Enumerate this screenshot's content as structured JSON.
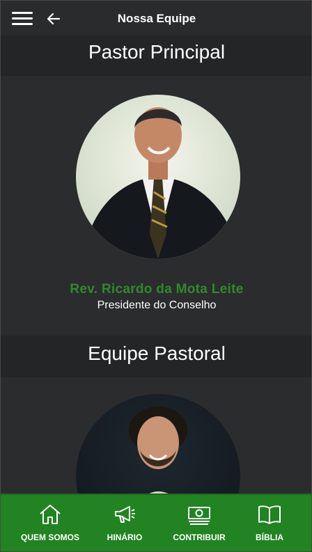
{
  "header": {
    "title": "Nossa Equipe",
    "menu_icon": "hamburger-menu-icon",
    "back_icon": "arrow-left-icon"
  },
  "sections": [
    {
      "title": "Pastor Principal"
    },
    {
      "title": "Equipe Pastoral"
    }
  ],
  "lead_pastor": {
    "name": "Rev. Ricardo da Mota Leite",
    "role": "Presidente do Conselho"
  },
  "nav": [
    {
      "label": "QUEM SOMOS",
      "icon": "home-icon"
    },
    {
      "label": "HINÁRIO",
      "icon": "megaphone-icon"
    },
    {
      "label": "CONTRIBUIR",
      "icon": "money-icon"
    },
    {
      "label": "BÍBLIA",
      "icon": "book-icon"
    }
  ],
  "colors": {
    "accent_green": "#218321",
    "name_green": "#2f8a2b",
    "background": "#2b2c2e"
  }
}
